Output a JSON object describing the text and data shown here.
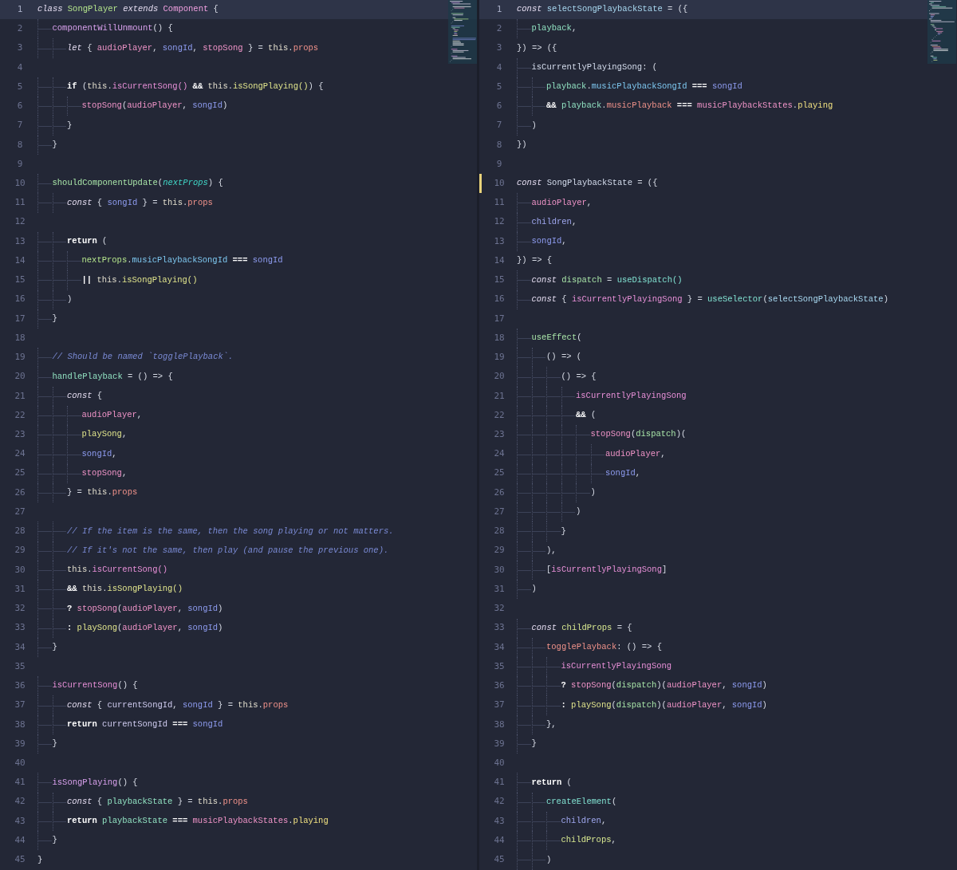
{
  "panes": [
    {
      "lines": [
        {
          "number": "1",
          "current": true,
          "modified": false,
          "tokens": [
            {
              "text": "class ",
              "kind": "keyword"
            },
            {
              "text": "SongPlayer ",
              "kind": "class"
            },
            {
              "text": "extends ",
              "kind": "keyword"
            },
            {
              "text": "Component",
              "kind": "super"
            },
            {
              "text": " {"
            }
          ]
        },
        {
          "number": "2",
          "current": false,
          "modified": false,
          "tokens": [
            {
              "text": "\tcomponentWillUnmount",
              "kind": "method"
            },
            {
              "text": "() {"
            }
          ]
        },
        {
          "number": "3",
          "current": false,
          "modified": false,
          "tokens": [
            {
              "text": "\t\tlet",
              "kind": "keyword"
            },
            {
              "text": " { "
            },
            {
              "text": "audioPlayer",
              "kind": "variable"
            },
            {
              "text": ", "
            },
            {
              "text": "songId",
              "kind": "parameter"
            },
            {
              "text": ", "
            },
            {
              "text": "stopSong",
              "kind": "variable"
            },
            {
              "text": " } = "
            },
            {
              "text": "this",
              "kind": "self"
            },
            {
              "text": "."
            },
            {
              "text": "props",
              "kind": "property"
            }
          ]
        },
        {
          "number": "4",
          "current": false,
          "modified": false
        },
        {
          "number": "5",
          "current": false,
          "modified": false,
          "tokens": [
            {
              "text": "\t\tif",
              "kind": "control"
            },
            {
              "text": " ("
            },
            {
              "text": "this",
              "kind": "self"
            },
            {
              "text": "."
            },
            {
              "text": "isCurrentSong() ",
              "kind": "member"
            },
            {
              "text": "&& ",
              "kind": "control"
            },
            {
              "text": "this",
              "kind": "self"
            },
            {
              "text": "."
            },
            {
              "text": "isSongPlaying()",
              "kind": "function"
            },
            {
              "text": ") {"
            }
          ]
        },
        {
          "number": "6",
          "current": false,
          "modified": false,
          "tokens": [
            {
              "text": "\t\t\tstopSong",
              "kind": "variable"
            },
            {
              "text": "("
            },
            {
              "text": "audioPlayer",
              "kind": "variable"
            },
            {
              "text": ", "
            },
            {
              "text": "songId",
              "kind": "parameter"
            },
            {
              "text": ")"
            }
          ]
        },
        {
          "number": "7",
          "current": false,
          "modified": false,
          "tokens": [
            {
              "text": "\t\t}"
            }
          ]
        },
        {
          "number": "8",
          "current": false,
          "modified": false,
          "tokens": [
            {
              "text": "\t}"
            }
          ]
        },
        {
          "number": "9",
          "current": false,
          "modified": false
        },
        {
          "number": "10",
          "current": false,
          "modified": false,
          "tokens": [
            {
              "text": "\tshouldComponentUpdate",
              "kind": "lifecycle"
            },
            {
              "text": "("
            },
            {
              "text": "nextProps",
              "kind": "argument"
            },
            {
              "text": ") {"
            }
          ]
        },
        {
          "number": "11",
          "current": false,
          "modified": false,
          "tokens": [
            {
              "text": "\t\tconst",
              "kind": "keyword"
            },
            {
              "text": " { "
            },
            {
              "text": "songId",
              "kind": "parameter"
            },
            {
              "text": " } = "
            },
            {
              "text": "this",
              "kind": "self"
            },
            {
              "text": "."
            },
            {
              "text": "props",
              "kind": "property"
            }
          ]
        },
        {
          "number": "12",
          "current": false,
          "modified": false
        },
        {
          "number": "13",
          "current": false,
          "modified": false,
          "tokens": [
            {
              "text": "\t\treturn",
              "kind": "control"
            },
            {
              "text": " ("
            }
          ]
        },
        {
          "number": "14",
          "current": false,
          "modified": false,
          "tokens": [
            {
              "text": "\t\t\tnextProps",
              "kind": "class"
            },
            {
              "text": "."
            },
            {
              "text": "musicPlaybackSongId ",
              "kind": "field"
            },
            {
              "text": "=== ",
              "kind": "control"
            },
            {
              "text": "songId",
              "kind": "parameter"
            }
          ]
        },
        {
          "number": "15",
          "current": false,
          "modified": false,
          "tokens": [
            {
              "text": "\t\t\t|| ",
              "kind": "control"
            },
            {
              "text": "this",
              "kind": "self"
            },
            {
              "text": "."
            },
            {
              "text": "isSongPlaying()",
              "kind": "function"
            }
          ]
        },
        {
          "number": "16",
          "current": false,
          "modified": false,
          "tokens": [
            {
              "text": "\t\t)"
            }
          ]
        },
        {
          "number": "17",
          "current": false,
          "modified": false,
          "tokens": [
            {
              "text": "\t}"
            }
          ]
        },
        {
          "number": "18",
          "current": false,
          "modified": false
        },
        {
          "number": "19",
          "current": false,
          "modified": false,
          "tokens": [
            {
              "text": "\t// Should be named `togglePlayback`.",
              "kind": "comment"
            }
          ]
        },
        {
          "number": "20",
          "current": false,
          "modified": false,
          "tokens": [
            {
              "text": "\thandlePlayback",
              "kind": "handler"
            },
            {
              "text": " = () => {"
            }
          ]
        },
        {
          "number": "21",
          "current": false,
          "modified": false,
          "tokens": [
            {
              "text": "\t\tconst",
              "kind": "keyword"
            },
            {
              "text": " {"
            }
          ]
        },
        {
          "number": "22",
          "current": false,
          "modified": false,
          "tokens": [
            {
              "text": "\t\t\taudioPlayer",
              "kind": "variable"
            },
            {
              "text": ","
            }
          ]
        },
        {
          "number": "23",
          "current": false,
          "modified": false,
          "tokens": [
            {
              "text": "\t\t\tplaySong",
              "kind": "function"
            },
            {
              "text": ","
            }
          ]
        },
        {
          "number": "24",
          "current": false,
          "modified": false,
          "tokens": [
            {
              "text": "\t\t\tsongId",
              "kind": "parameter"
            },
            {
              "text": ","
            }
          ]
        },
        {
          "number": "25",
          "current": false,
          "modified": false,
          "tokens": [
            {
              "text": "\t\t\tstopSong",
              "kind": "variable"
            },
            {
              "text": ","
            }
          ]
        },
        {
          "number": "26",
          "current": false,
          "modified": false,
          "tokens": [
            {
              "text": "\t\t} = "
            },
            {
              "text": "this",
              "kind": "self"
            },
            {
              "text": "."
            },
            {
              "text": "props",
              "kind": "property"
            }
          ]
        },
        {
          "number": "27",
          "current": false,
          "modified": false
        },
        {
          "number": "28",
          "current": false,
          "modified": false,
          "tokens": [
            {
              "text": "\t\t// If the item is the same, then the song playing or not matters.",
              "kind": "comment"
            }
          ]
        },
        {
          "number": "29",
          "current": false,
          "modified": false,
          "tokens": [
            {
              "text": "\t\t// If it's not the same, then play (and pause the previous one).",
              "kind": "comment"
            }
          ]
        },
        {
          "number": "30",
          "current": false,
          "modified": false,
          "tokens": [
            {
              "text": "\t\tthis",
              "kind": "self"
            },
            {
              "text": "."
            },
            {
              "text": "isCurrentSong()",
              "kind": "member"
            }
          ]
        },
        {
          "number": "31",
          "current": false,
          "modified": false,
          "tokens": [
            {
              "text": "\t\t&& ",
              "kind": "control"
            },
            {
              "text": "this",
              "kind": "self"
            },
            {
              "text": "."
            },
            {
              "text": "isSongPlaying()",
              "kind": "function"
            }
          ]
        },
        {
          "number": "32",
          "current": false,
          "modified": false,
          "tokens": [
            {
              "text": "\t\t? ",
              "kind": "control"
            },
            {
              "text": "stopSong",
              "kind": "variable"
            },
            {
              "text": "("
            },
            {
              "text": "audioPlayer",
              "kind": "variable"
            },
            {
              "text": ", "
            },
            {
              "text": "songId",
              "kind": "parameter"
            },
            {
              "text": ")"
            }
          ]
        },
        {
          "number": "33",
          "current": false,
          "modified": false,
          "tokens": [
            {
              "text": "\t\t: ",
              "kind": "control"
            },
            {
              "text": "playSong",
              "kind": "function"
            },
            {
              "text": "("
            },
            {
              "text": "audioPlayer",
              "kind": "variable"
            },
            {
              "text": ", "
            },
            {
              "text": "songId",
              "kind": "parameter"
            },
            {
              "text": ")"
            }
          ]
        },
        {
          "number": "34",
          "current": false,
          "modified": false,
          "tokens": [
            {
              "text": "\t}"
            }
          ]
        },
        {
          "number": "35",
          "current": false,
          "modified": false
        },
        {
          "number": "36",
          "current": false,
          "modified": false,
          "tokens": [
            {
              "text": "\tisCurrentSong",
              "kind": "member"
            },
            {
              "text": "() {"
            }
          ]
        },
        {
          "number": "37",
          "current": false,
          "modified": false,
          "tokens": [
            {
              "text": "\t\tconst",
              "kind": "keyword"
            },
            {
              "text": " { "
            },
            {
              "text": "currentSongId",
              "kind": "local"
            },
            {
              "text": ", "
            },
            {
              "text": "songId",
              "kind": "parameter"
            },
            {
              "text": " } = "
            },
            {
              "text": "this",
              "kind": "self"
            },
            {
              "text": "."
            },
            {
              "text": "props",
              "kind": "property"
            }
          ]
        },
        {
          "number": "38",
          "current": false,
          "modified": false,
          "tokens": [
            {
              "text": "\t\treturn ",
              "kind": "control"
            },
            {
              "text": "currentSongId ",
              "kind": "local"
            },
            {
              "text": "=== ",
              "kind": "control"
            },
            {
              "text": "songId",
              "kind": "parameter"
            }
          ]
        },
        {
          "number": "39",
          "current": false,
          "modified": false,
          "tokens": [
            {
              "text": "\t}"
            }
          ]
        },
        {
          "number": "40",
          "current": false,
          "modified": false
        },
        {
          "number": "41",
          "current": false,
          "modified": false,
          "tokens": [
            {
              "text": "\tisSongPlaying",
              "kind": "method"
            },
            {
              "text": "() {"
            }
          ]
        },
        {
          "number": "42",
          "current": false,
          "modified": false,
          "tokens": [
            {
              "text": "\t\tconst",
              "kind": "keyword"
            },
            {
              "text": " { "
            },
            {
              "text": "playbackState",
              "kind": "handler"
            },
            {
              "text": " } = "
            },
            {
              "text": "this",
              "kind": "self"
            },
            {
              "text": "."
            },
            {
              "text": "props",
              "kind": "property"
            }
          ]
        },
        {
          "number": "43",
          "current": false,
          "modified": false,
          "tokens": [
            {
              "text": "\t\treturn ",
              "kind": "control"
            },
            {
              "text": "playbackState ",
              "kind": "handler"
            },
            {
              "text": "=== ",
              "kind": "control"
            },
            {
              "text": "musicPlaybackStates",
              "kind": "variable"
            },
            {
              "text": "."
            },
            {
              "text": "playing",
              "kind": "enum"
            }
          ]
        },
        {
          "number": "44",
          "current": false,
          "modified": false,
          "tokens": [
            {
              "text": "\t}"
            }
          ]
        },
        {
          "number": "45",
          "current": false,
          "modified": false,
          "tokens": [
            {
              "text": "}"
            }
          ]
        }
      ]
    },
    {
      "lines": [
        {
          "number": "1",
          "current": true,
          "modified": false,
          "tokens": [
            {
              "text": "const ",
              "kind": "keyword"
            },
            {
              "text": "selectSongPlaybackState",
              "kind": "selector"
            },
            {
              "text": " = ({"
            }
          ]
        },
        {
          "number": "2",
          "current": false,
          "modified": false,
          "tokens": [
            {
              "text": "\tplayback",
              "kind": "handler"
            },
            {
              "text": ","
            }
          ]
        },
        {
          "number": "3",
          "current": false,
          "modified": false,
          "tokens": [
            {
              "text": "}) => ({"
            }
          ]
        },
        {
          "number": "4",
          "current": false,
          "modified": false,
          "tokens": [
            {
              "text": "\tisCurrentlyPlayingSong",
              "kind": "declaration"
            },
            {
              "text": ": ("
            }
          ]
        },
        {
          "number": "5",
          "current": false,
          "modified": false,
          "tokens": [
            {
              "text": "\t\tplayback",
              "kind": "handler"
            },
            {
              "text": "."
            },
            {
              "text": "musicPlaybackSongId ",
              "kind": "field"
            },
            {
              "text": "=== ",
              "kind": "control"
            },
            {
              "text": "songId",
              "kind": "parameter"
            }
          ]
        },
        {
          "number": "6",
          "current": false,
          "modified": false,
          "tokens": [
            {
              "text": "\t\t&& ",
              "kind": "control"
            },
            {
              "text": "playback",
              "kind": "handler"
            },
            {
              "text": "."
            },
            {
              "text": "musicPlayback ",
              "kind": "property"
            },
            {
              "text": "=== ",
              "kind": "control"
            },
            {
              "text": "musicPlaybackStates",
              "kind": "variable"
            },
            {
              "text": "."
            },
            {
              "text": "playing",
              "kind": "enum"
            }
          ]
        },
        {
          "number": "7",
          "current": false,
          "modified": false,
          "tokens": [
            {
              "text": "\t)"
            }
          ]
        },
        {
          "number": "8",
          "current": false,
          "modified": false,
          "tokens": [
            {
              "text": "})"
            }
          ]
        },
        {
          "number": "9",
          "current": false,
          "modified": false
        },
        {
          "number": "10",
          "current": false,
          "modified": true,
          "tokens": [
            {
              "text": "const ",
              "kind": "keyword"
            },
            {
              "text": "SongPlaybackState",
              "kind": "declaration"
            },
            {
              "text": " = ({"
            }
          ]
        },
        {
          "number": "11",
          "current": false,
          "modified": false,
          "tokens": [
            {
              "text": "\taudioPlayer",
              "kind": "variable"
            },
            {
              "text": ","
            }
          ]
        },
        {
          "number": "12",
          "current": false,
          "modified": false,
          "tokens": [
            {
              "text": "\tchildren",
              "kind": "child"
            },
            {
              "text": ","
            }
          ]
        },
        {
          "number": "13",
          "current": false,
          "modified": false,
          "tokens": [
            {
              "text": "\tsongId",
              "kind": "parameter"
            },
            {
              "text": ","
            }
          ]
        },
        {
          "number": "14",
          "current": false,
          "modified": false,
          "tokens": [
            {
              "text": "}) => {"
            }
          ]
        },
        {
          "number": "15",
          "current": false,
          "modified": false,
          "tokens": [
            {
              "text": "\tconst ",
              "kind": "keyword"
            },
            {
              "text": "dispatch",
              "kind": "lifecycle"
            },
            {
              "text": " = "
            },
            {
              "text": "useDispatch()",
              "kind": "hook"
            }
          ]
        },
        {
          "number": "16",
          "current": false,
          "modified": false,
          "tokens": [
            {
              "text": "\tconst",
              "kind": "keyword"
            },
            {
              "text": " { "
            },
            {
              "text": "isCurrentlyPlayingSong",
              "kind": "member"
            },
            {
              "text": " } = "
            },
            {
              "text": "useSelector",
              "kind": "hook"
            },
            {
              "text": "("
            },
            {
              "text": "selectSongPlaybackState",
              "kind": "selector"
            },
            {
              "text": ")"
            }
          ]
        },
        {
          "number": "17",
          "current": false,
          "modified": false
        },
        {
          "number": "18",
          "current": false,
          "modified": false,
          "tokens": [
            {
              "text": "\tuseEffect",
              "kind": "lifecycle"
            },
            {
              "text": "("
            }
          ]
        },
        {
          "number": "19",
          "current": false,
          "modified": false,
          "tokens": [
            {
              "text": "\t\t() => ("
            }
          ]
        },
        {
          "number": "20",
          "current": false,
          "modified": false,
          "tokens": [
            {
              "text": "\t\t\t() => {"
            }
          ]
        },
        {
          "number": "21",
          "current": false,
          "modified": false,
          "tokens": [
            {
              "text": "\t\t\t\tisCurrentlyPlayingSong",
              "kind": "member"
            }
          ]
        },
        {
          "number": "22",
          "current": false,
          "modified": false,
          "tokens": [
            {
              "text": "\t\t\t\t&&",
              "kind": "control"
            },
            {
              "text": " ("
            }
          ]
        },
        {
          "number": "23",
          "current": false,
          "modified": false,
          "tokens": [
            {
              "text": "\t\t\t\t\tstopSong",
              "kind": "variable"
            },
            {
              "text": "("
            },
            {
              "text": "dispatch",
              "kind": "lifecycle"
            },
            {
              "text": ")("
            }
          ]
        },
        {
          "number": "24",
          "current": false,
          "modified": false,
          "tokens": [
            {
              "text": "\t\t\t\t\t\taudioPlayer",
              "kind": "variable"
            },
            {
              "text": ","
            }
          ]
        },
        {
          "number": "25",
          "current": false,
          "modified": false,
          "tokens": [
            {
              "text": "\t\t\t\t\t\tsongId",
              "kind": "parameter"
            },
            {
              "text": ","
            }
          ]
        },
        {
          "number": "26",
          "current": false,
          "modified": false,
          "tokens": [
            {
              "text": "\t\t\t\t\t)"
            }
          ]
        },
        {
          "number": "27",
          "current": false,
          "modified": false,
          "tokens": [
            {
              "text": "\t\t\t\t)"
            }
          ]
        },
        {
          "number": "28",
          "current": false,
          "modified": false,
          "tokens": [
            {
              "text": "\t\t\t}"
            }
          ]
        },
        {
          "number": "29",
          "current": false,
          "modified": false,
          "tokens": [
            {
              "text": "\t\t),"
            }
          ]
        },
        {
          "number": "30",
          "current": false,
          "modified": false,
          "tokens": [
            {
              "text": "\t\t["
            },
            {
              "text": "isCurrentlyPlayingSong",
              "kind": "member"
            },
            {
              "text": "]"
            }
          ]
        },
        {
          "number": "31",
          "current": false,
          "modified": false,
          "tokens": [
            {
              "text": "\t)"
            }
          ]
        },
        {
          "number": "32",
          "current": false,
          "modified": false
        },
        {
          "number": "33",
          "current": false,
          "modified": false,
          "tokens": [
            {
              "text": "\tconst ",
              "kind": "keyword"
            },
            {
              "text": "childProps",
              "kind": "constant"
            },
            {
              "text": " = {"
            }
          ]
        },
        {
          "number": "34",
          "current": false,
          "modified": false,
          "tokens": [
            {
              "text": "\t\ttogglePlayback",
              "kind": "property"
            },
            {
              "text": ": () => {"
            }
          ]
        },
        {
          "number": "35",
          "current": false,
          "modified": false,
          "tokens": [
            {
              "text": "\t\t\tisCurrentlyPlayingSong",
              "kind": "member"
            }
          ]
        },
        {
          "number": "36",
          "current": false,
          "modified": false,
          "tokens": [
            {
              "text": "\t\t\t? ",
              "kind": "control"
            },
            {
              "text": "stopSong",
              "kind": "variable"
            },
            {
              "text": "("
            },
            {
              "text": "dispatch",
              "kind": "lifecycle"
            },
            {
              "text": ")("
            },
            {
              "text": "audioPlayer",
              "kind": "variable"
            },
            {
              "text": ", "
            },
            {
              "text": "songId",
              "kind": "parameter"
            },
            {
              "text": ")"
            }
          ]
        },
        {
          "number": "37",
          "current": false,
          "modified": false,
          "tokens": [
            {
              "text": "\t\t\t: ",
              "kind": "control"
            },
            {
              "text": "playSong",
              "kind": "function"
            },
            {
              "text": "("
            },
            {
              "text": "dispatch",
              "kind": "lifecycle"
            },
            {
              "text": ")("
            },
            {
              "text": "audioPlayer",
              "kind": "variable"
            },
            {
              "text": ", "
            },
            {
              "text": "songId",
              "kind": "parameter"
            },
            {
              "text": ")"
            }
          ]
        },
        {
          "number": "38",
          "current": false,
          "modified": false,
          "tokens": [
            {
              "text": "\t\t},"
            }
          ]
        },
        {
          "number": "39",
          "current": false,
          "modified": false,
          "tokens": [
            {
              "text": "\t}"
            }
          ]
        },
        {
          "number": "40",
          "current": false,
          "modified": false
        },
        {
          "number": "41",
          "current": false,
          "modified": false,
          "tokens": [
            {
              "text": "\treturn",
              "kind": "control"
            },
            {
              "text": " ("
            }
          ]
        },
        {
          "number": "42",
          "current": false,
          "modified": false,
          "tokens": [
            {
              "text": "\t\tcreateElement",
              "kind": "hook"
            },
            {
              "text": "("
            }
          ]
        },
        {
          "number": "43",
          "current": false,
          "modified": false,
          "tokens": [
            {
              "text": "\t\t\tchildren",
              "kind": "child"
            },
            {
              "text": ","
            }
          ]
        },
        {
          "number": "44",
          "current": false,
          "modified": false,
          "tokens": [
            {
              "text": "\t\t\tchildProps",
              "kind": "constant"
            },
            {
              "text": ","
            }
          ]
        },
        {
          "number": "45",
          "current": false,
          "modified": false,
          "tokens": [
            {
              "text": "\t\t)"
            }
          ]
        }
      ]
    }
  ]
}
